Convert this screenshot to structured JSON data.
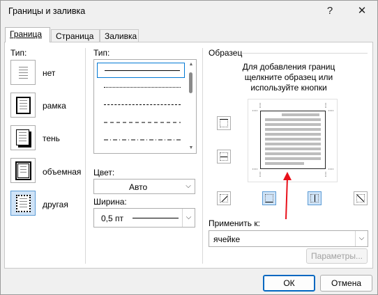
{
  "window": {
    "title": "Границы и заливка",
    "help_glyph": "?",
    "close_glyph": "✕"
  },
  "tabs": [
    {
      "label": "Граница",
      "active": true
    },
    {
      "label": "Страница",
      "active": false
    },
    {
      "label": "Заливка",
      "active": false
    }
  ],
  "type_section": {
    "header": "Тип:",
    "presets": [
      {
        "label": "нет"
      },
      {
        "label": "рамка"
      },
      {
        "label": "тень"
      },
      {
        "label": "объемная"
      },
      {
        "label": "другая",
        "selected": true
      }
    ]
  },
  "style_section": {
    "header": "Тип:",
    "styles": [
      "solid",
      "dotted",
      "dashed",
      "dash-large",
      "dash-dot"
    ],
    "selected_index": 0,
    "color_label": "Цвет:",
    "color_value": "Авто",
    "width_label": "Ширина:",
    "width_value": "0,5 пт"
  },
  "preview_section": {
    "header": "Образец",
    "hint_line1": "Для добавления границ",
    "hint_line2": "щелкните образец или",
    "hint_line3": "используйте кнопки",
    "apply_label": "Применить к:",
    "apply_value": "ячейке",
    "options_button": "Параметры..."
  },
  "footer": {
    "ok": "ОК",
    "cancel": "Отмена"
  },
  "colors": {
    "accent": "#0067c0",
    "arrow": "#e8101a",
    "selected_bg": "#cfe3f7"
  }
}
